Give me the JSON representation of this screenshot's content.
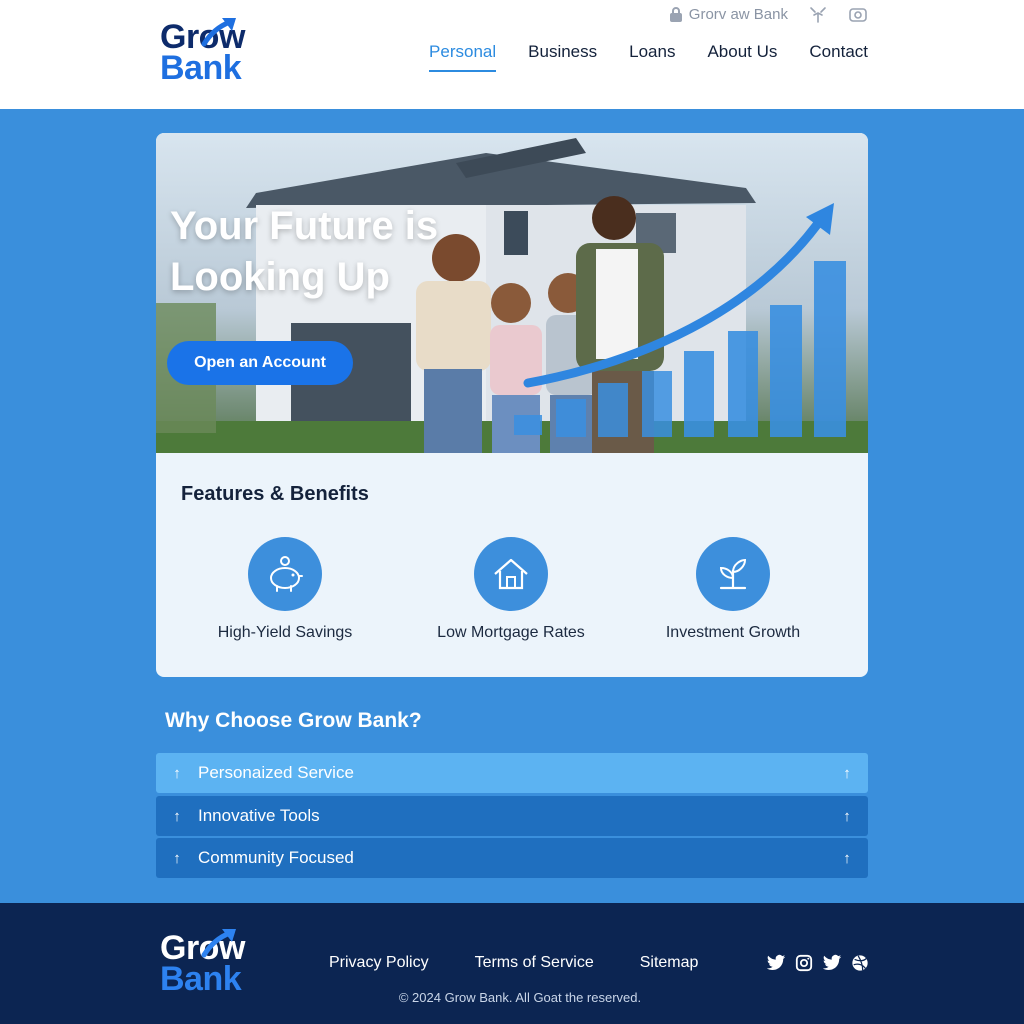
{
  "brand": {
    "line1": "Grow",
    "line2": "Bank",
    "primary": "#0d2b6b",
    "accent": "#1e6fe0"
  },
  "topbar": {
    "login_label": "Grorv aw Bank",
    "icons": [
      "lock-icon",
      "tree-icon",
      "photo-icon"
    ]
  },
  "nav": [
    {
      "label": "Personal",
      "active": true
    },
    {
      "label": "Business"
    },
    {
      "label": "Loans"
    },
    {
      "label": "About Us"
    },
    {
      "label": "Contact"
    }
  ],
  "hero": {
    "title": "Your Future is Looking Up",
    "cta": "Open an Account"
  },
  "features": {
    "title": "Features & Benefits",
    "items": [
      {
        "label": "High-Yield Savings",
        "icon": "piggy-bank-icon"
      },
      {
        "label": "Low Mortgage Rates",
        "icon": "house-icon"
      },
      {
        "label": "Investment Growth",
        "icon": "plant-icon"
      }
    ]
  },
  "why": {
    "title": "Why Choose Grow Bank?",
    "items": [
      {
        "label": "Personaized Service"
      },
      {
        "label": "Innovative Tools"
      },
      {
        "label": "Community Focused"
      }
    ]
  },
  "footer": {
    "links": [
      "Privacy Policy",
      "Terms of Service",
      "Sitemap"
    ],
    "social": [
      "twitter-icon",
      "instagram-icon",
      "twitter-icon",
      "dribbble-icon"
    ],
    "copyright": "© 2024 Grow Bank. All Goat the reserved."
  },
  "colors": {
    "page_bg": "#3a8fdc",
    "footer_bg": "#0c2552",
    "cta": "#1a73e8",
    "nav_active": "#2c8be0"
  }
}
